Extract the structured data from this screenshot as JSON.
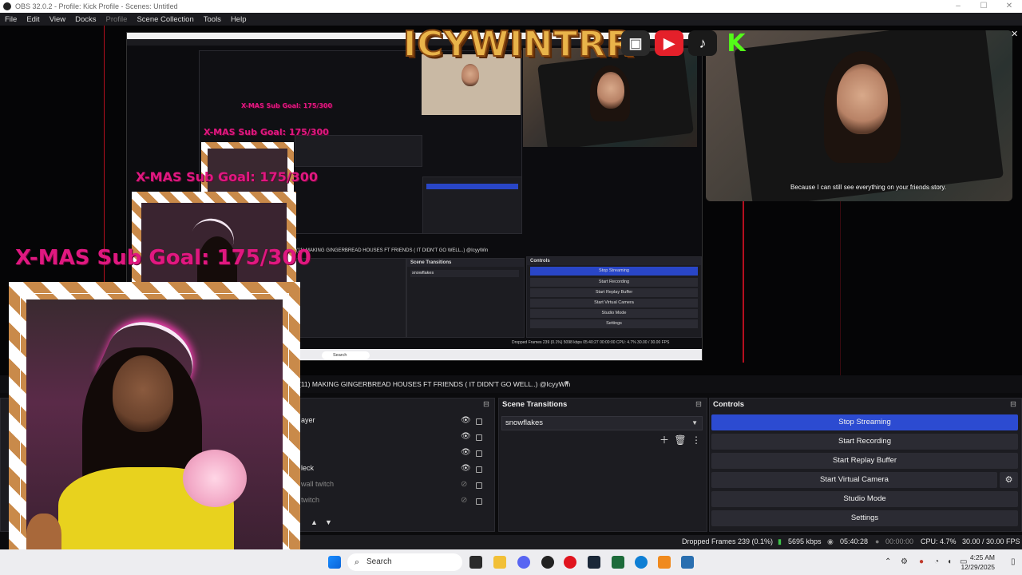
{
  "window": {
    "title": "OBS 32.0.2 - Profile: Kick Profile - Scenes: Untitled",
    "controls": [
      "–",
      "☐",
      "✕"
    ]
  },
  "menu": {
    "file": "File",
    "edit": "Edit",
    "view": "View",
    "docks": "Docks",
    "profile": "Profile",
    "scene_collection": "Scene Collection",
    "tools": "Tools",
    "help": "Help"
  },
  "overlay": {
    "brand": "ICYWINTRR",
    "goal_text": "X-MAS Sub Goal: 175/300",
    "caption": "Because I can still see everything on your friends story."
  },
  "scene_title": "(11) MAKING GINGERBREAD HOUSES FT FRIENDS ( IT DIDN'T GO WELL..) @IcyyWin",
  "sources": {
    "items": [
      "ayer",
      "",
      "",
      "leck",
      "wall twitch",
      "twitch"
    ]
  },
  "transitions": {
    "header": "Scene Transitions",
    "selected": "snowflakes"
  },
  "controls": {
    "header": "Controls",
    "stop_streaming": "Stop Streaming",
    "start_recording": "Start Recording",
    "start_replay_buffer": "Start Replay Buffer",
    "start_virtual_camera": "Start Virtual Camera",
    "studio_mode": "Studio Mode",
    "settings": "Settings"
  },
  "status": {
    "dropped_frames": "Dropped Frames 239 (0.1%)",
    "bitrate": "5695 kbps",
    "stream_time": "05:40:28",
    "rec_time": "00:00:00",
    "cpu": "CPU: 4.7%",
    "fps": "30.00 / 30.00 FPS"
  },
  "taskbar": {
    "search_label": "Search",
    "time": "4:25 AM",
    "date": "12/29/2025"
  },
  "nested": {
    "stop_streaming": "Stop Streaming",
    "start_recording": "Start Recording",
    "start_replay_buffer": "Start Replay Buffer",
    "start_virtual_camera": "Start Virtual Camera",
    "studio_mode": "Studio Mode",
    "settings": "Settings",
    "transitions": "Scene Transitions",
    "controls": "Controls",
    "selected": "snowflakes",
    "scene_title": "(11) MAKING GINGERBREAD HOUSES FT FRIENDS ( IT DIDN'T GO WELL..) @IcyyWin",
    "status": "Dropped Frames 239 (0.1%)   5098 kbps   05:40:27   00:00:00   CPU: 4.7%   30.00 / 30.00 FPS",
    "search": "Search"
  },
  "colors": {
    "accent": "#2c4bd1",
    "goal": "#e01880",
    "brand": "#e9b44a",
    "redline": "#b40f1e"
  }
}
